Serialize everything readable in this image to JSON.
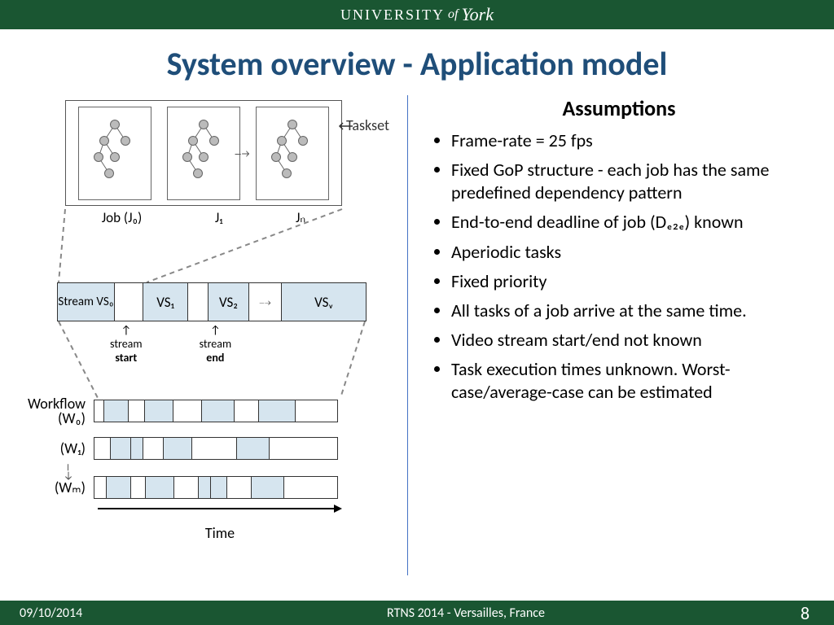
{
  "header": {
    "university": "UNIVERSITY",
    "of": "of",
    "york": "York"
  },
  "title": "System overview - Application model",
  "diagram": {
    "taskset_label": "Taskset",
    "jobs": [
      "Job (J₀)",
      "J₁",
      "Jₙ"
    ],
    "stream_cells": [
      "Stream VS₀",
      "VS₁",
      "VS₂",
      "VSᵥ"
    ],
    "stream_start": "stream",
    "stream_start_bold": "start",
    "stream_end": "stream",
    "stream_end_bold": "end",
    "workflow_labels": [
      "Workflow (W₀)",
      "(W₁)",
      "(Wₘ)"
    ],
    "time_label": "Time"
  },
  "assumptions": {
    "heading": "Assumptions",
    "items": [
      "Frame-rate = 25 fps",
      "Fixed GoP structure - each job has the same predefined dependency pattern",
      "End-to-end deadline of job (Dₑ₂ₑ) known",
      "Aperiodic tasks",
      "Fixed priority",
      "All tasks of a job arrive at the same time.",
      "Video stream start/end not known",
      "Task execution times unknown. Worst-case/average-case can be estimated"
    ]
  },
  "footer": {
    "date": "09/10/2014",
    "venue": "RTNS 2014 - Versailles, France",
    "page": "8"
  }
}
